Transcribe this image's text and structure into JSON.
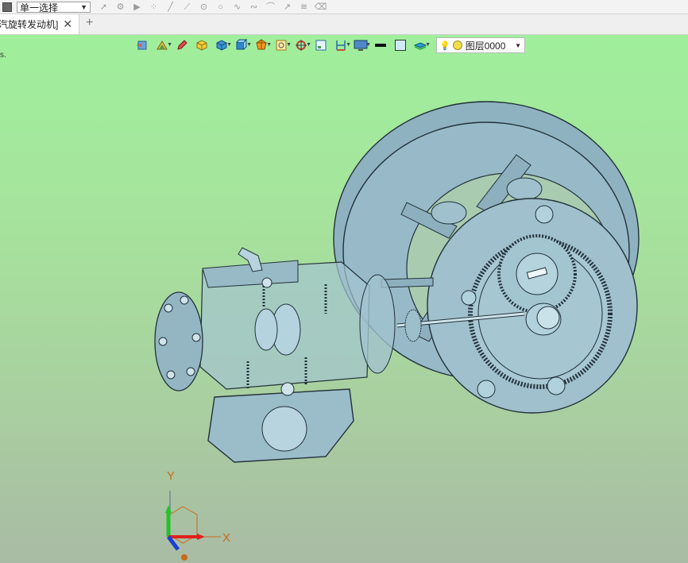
{
  "topbar": {
    "selection_mode": "单一选择"
  },
  "tabs": [
    {
      "label": "汽旋转发动机]"
    }
  ],
  "viewport": {
    "stray_text": "s.",
    "layer": {
      "label": "图层0000"
    },
    "axes": {
      "x": "X",
      "y": "Y"
    },
    "background_top": "#9fef9c",
    "background_bottom": "#a9bba4",
    "model_color": "#97b9c7"
  }
}
